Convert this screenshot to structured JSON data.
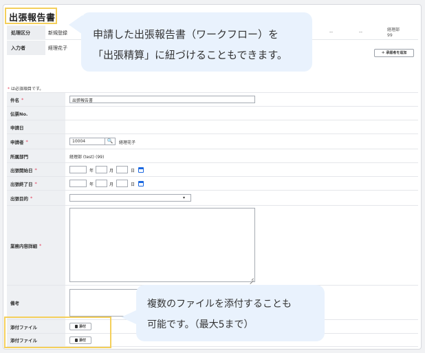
{
  "page": {
    "title": "出張報告書"
  },
  "header": {
    "process_type_label": "処理区分",
    "process_type_value": "新規登録",
    "entrant_label": "入力者",
    "entrant_value": "経理花子",
    "dash1": "--",
    "dash2": "--",
    "dept_line1": "経理部",
    "dept_line2": "99",
    "add_approver": "＋ 承認者を追加"
  },
  "required_note": {
    "asterisk": "*",
    "text": " は必須項目です。"
  },
  "form": {
    "subject": {
      "label": "件名",
      "required": "*",
      "value": "出張報告書"
    },
    "slip_no": {
      "label": "伝票No."
    },
    "apply_date": {
      "label": "申請日"
    },
    "applicant": {
      "label": "申請者",
      "required": "*",
      "code": "10004",
      "search_icon": "🔍",
      "name": "経理花子"
    },
    "department": {
      "label": "所属部門",
      "value": "経理部 (test) (99)"
    },
    "start_date": {
      "label": "出張開始日",
      "required": "*",
      "year": "年",
      "month": "月",
      "day": "日"
    },
    "end_date": {
      "label": "出張終了日",
      "required": "*",
      "year": "年",
      "month": "月",
      "day": "日"
    },
    "purpose": {
      "label": "出張目的",
      "required": "*",
      "caret": "▾"
    },
    "details": {
      "label": "業務内容詳細",
      "required": "*"
    },
    "remarks": {
      "label": "備考"
    },
    "attachment1": {
      "label": "添付ファイル",
      "button": "添付"
    },
    "attachment2": {
      "label": "添付ファイル",
      "button": "添付"
    }
  },
  "callouts": {
    "top_line1": "申請した出張報告書（ワークフロー）を",
    "top_line2": "「出張精算」に紐づけることもできます。",
    "bottom_line1": "複数のファイルを添付することも",
    "bottom_line2": "可能です。（最大5まで）"
  },
  "colors": {
    "highlight": "#f4cf5a",
    "bubble": "#e9f2fd",
    "required": "#e53b57",
    "calendar": "#1b68e0"
  }
}
